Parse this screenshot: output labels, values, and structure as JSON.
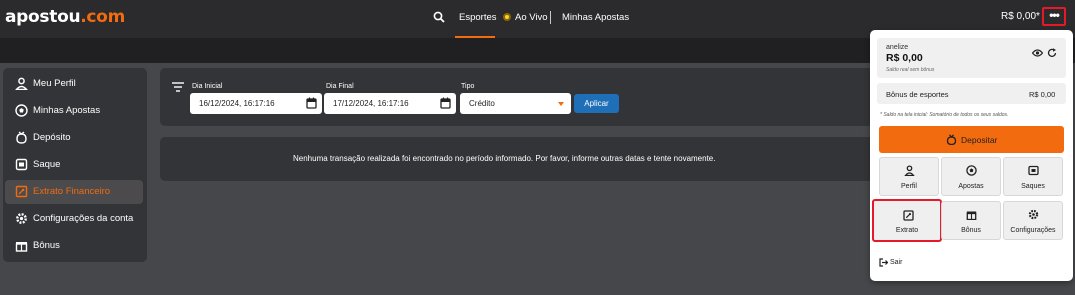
{
  "header": {
    "logo_text": "apostou",
    "logo_tld": ".com",
    "nav": [
      "Esportes",
      "Ao Vivo",
      "Minhas Apostas"
    ],
    "balance": "R$ 0,00*",
    "menu_button": "•••",
    "accent_color": "#f26b0f"
  },
  "sidebar": {
    "items": [
      {
        "label": "Meu Perfil",
        "icon": "user-icon"
      },
      {
        "label": "Minhas Apostas",
        "icon": "soccer-ball-icon"
      },
      {
        "label": "Depósito",
        "icon": "deposit-icon"
      },
      {
        "label": "Saque",
        "icon": "withdraw-icon"
      },
      {
        "label": "Extrato Financeiro",
        "icon": "statement-icon",
        "active": true
      },
      {
        "label": "Configurações da conta",
        "icon": "gear-icon"
      },
      {
        "label": "Bônus",
        "icon": "gift-icon"
      }
    ]
  },
  "filters": {
    "start_label": "Dia Inicial",
    "start_value": "16/12/2024, 16:17:16",
    "end_label": "Dia Final",
    "end_value": "17/12/2024, 16:17:16",
    "type_label": "Tipo",
    "type_value": "Crédito",
    "apply_label": "Aplicar"
  },
  "empty_message": "Nenhuma transação realizada foi encontrado no período informado. Por favor, informe outras datas e tente novamente.",
  "dropdown": {
    "username": "anelize",
    "balance": "R$ 0,00",
    "balance_note": "Saldo real sem bônus",
    "bonus_label": "Bônus de esportes",
    "bonus_value": "R$ 0,00",
    "footnote": "* Saldo na tela inicial: Somatório de todos os seus saldos.",
    "deposit_label": "Depositar",
    "tiles": [
      {
        "label": "Perfil",
        "icon": "user-icon"
      },
      {
        "label": "Apostas",
        "icon": "soccer-ball-icon"
      },
      {
        "label": "Saques",
        "icon": "withdraw-icon"
      },
      {
        "label": "Extrato",
        "icon": "statement-icon",
        "highlighted": true
      },
      {
        "label": "Bônus",
        "icon": "gift-icon"
      },
      {
        "label": "Configurações",
        "icon": "gear-icon"
      }
    ],
    "logout_label": "Sair"
  }
}
